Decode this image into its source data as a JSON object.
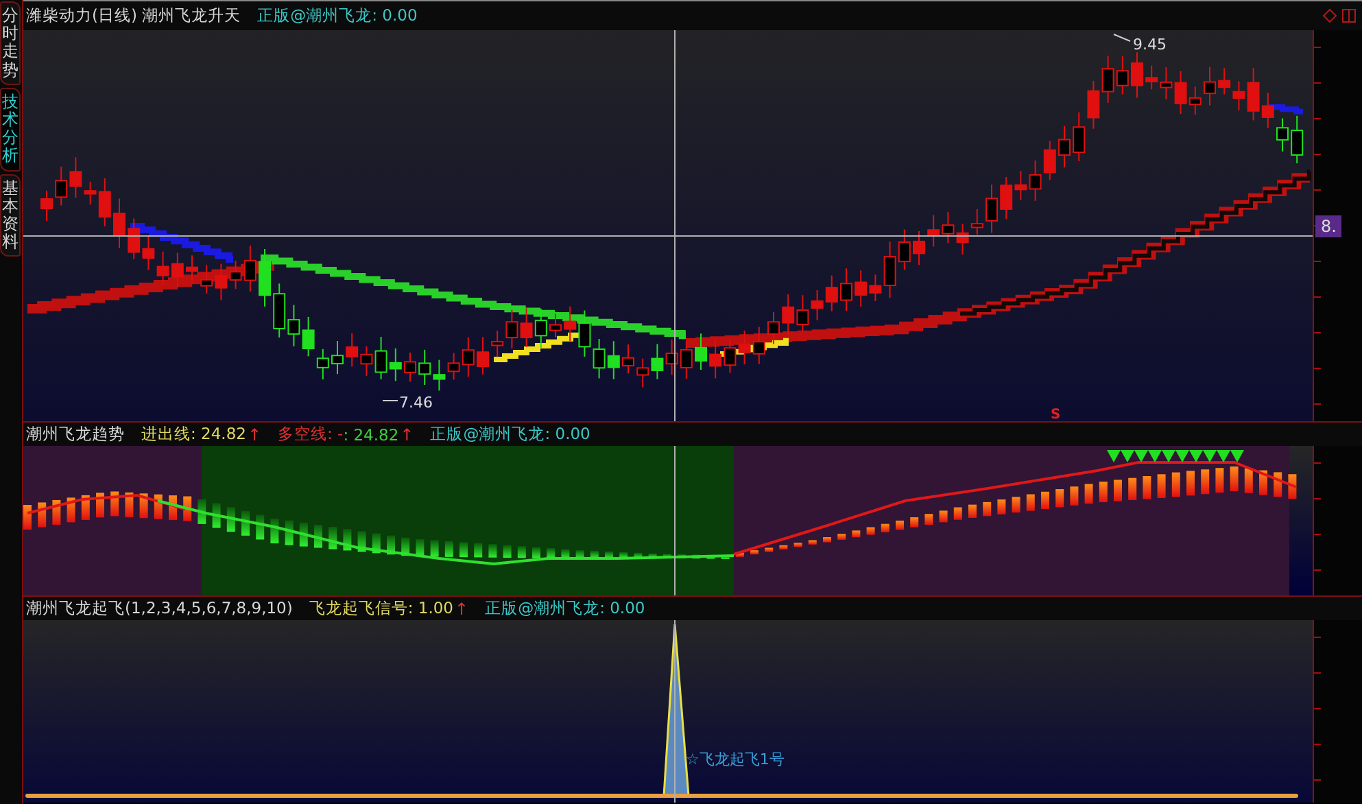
{
  "side_tabs": [
    {
      "label": "分时走势",
      "selected": false
    },
    {
      "label": "技术分析",
      "selected": true
    },
    {
      "label": "基本资料",
      "selected": false
    }
  ],
  "price_pane": {
    "security": "潍柴动力(日线)",
    "indicator": "潮州飞龙升天",
    "legend": [
      {
        "parts": [
          {
            "text": "正版@潮州飞龙: 0.00",
            "color": "#3cc8c8"
          }
        ]
      }
    ],
    "high_label": "9.45",
    "low_label": "7.46",
    "signal_mark": "S",
    "price_tag": "8."
  },
  "trend_pane": {
    "indicator": "潮州飞龙趋势",
    "legend": [
      {
        "parts": [
          {
            "text": "进出线: 24.82",
            "color": "#e0d860"
          }
        ],
        "arrow": "↑"
      },
      {
        "parts": [
          {
            "text": "多空线: -",
            "color": "#e03030"
          },
          {
            "text": ": 24.82",
            "color": "#3cd03c"
          }
        ],
        "arrow": "↑"
      },
      {
        "parts": [
          {
            "text": "正版@潮州飞龙: 0.00",
            "color": "#3cc8c8"
          }
        ]
      }
    ]
  },
  "signal_pane": {
    "indicator": "潮州飞龙起飞(1,2,3,4,5,6,7,8,9,10)",
    "legend": [
      {
        "parts": [
          {
            "text": "飞龙起飞信号: 1.00",
            "color": "#e0d860"
          }
        ],
        "arrow": "↑"
      },
      {
        "parts": [
          {
            "text": "正版@潮州飞龙: 0.00",
            "color": "#3cc8c8"
          }
        ]
      }
    ],
    "signal_label": "☆飞龙起飞1号"
  }
}
